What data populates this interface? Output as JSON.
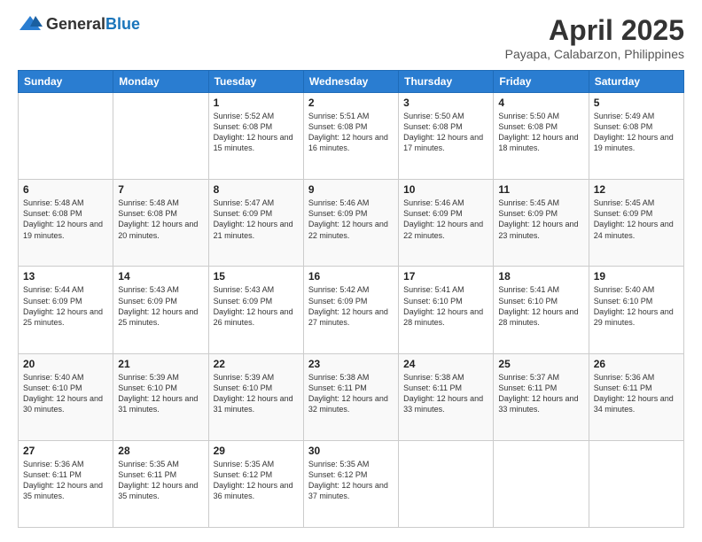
{
  "header": {
    "logo": {
      "general": "General",
      "blue": "Blue"
    },
    "title": "April 2025",
    "location": "Payapa, Calabarzon, Philippines"
  },
  "calendar": {
    "days_of_week": [
      "Sunday",
      "Monday",
      "Tuesday",
      "Wednesday",
      "Thursday",
      "Friday",
      "Saturday"
    ],
    "weeks": [
      [
        {
          "day": "",
          "info": ""
        },
        {
          "day": "",
          "info": ""
        },
        {
          "day": "1",
          "info": "Sunrise: 5:52 AM\nSunset: 6:08 PM\nDaylight: 12 hours and 15 minutes."
        },
        {
          "day": "2",
          "info": "Sunrise: 5:51 AM\nSunset: 6:08 PM\nDaylight: 12 hours and 16 minutes."
        },
        {
          "day": "3",
          "info": "Sunrise: 5:50 AM\nSunset: 6:08 PM\nDaylight: 12 hours and 17 minutes."
        },
        {
          "day": "4",
          "info": "Sunrise: 5:50 AM\nSunset: 6:08 PM\nDaylight: 12 hours and 18 minutes."
        },
        {
          "day": "5",
          "info": "Sunrise: 5:49 AM\nSunset: 6:08 PM\nDaylight: 12 hours and 19 minutes."
        }
      ],
      [
        {
          "day": "6",
          "info": "Sunrise: 5:48 AM\nSunset: 6:08 PM\nDaylight: 12 hours and 19 minutes."
        },
        {
          "day": "7",
          "info": "Sunrise: 5:48 AM\nSunset: 6:08 PM\nDaylight: 12 hours and 20 minutes."
        },
        {
          "day": "8",
          "info": "Sunrise: 5:47 AM\nSunset: 6:09 PM\nDaylight: 12 hours and 21 minutes."
        },
        {
          "day": "9",
          "info": "Sunrise: 5:46 AM\nSunset: 6:09 PM\nDaylight: 12 hours and 22 minutes."
        },
        {
          "day": "10",
          "info": "Sunrise: 5:46 AM\nSunset: 6:09 PM\nDaylight: 12 hours and 22 minutes."
        },
        {
          "day": "11",
          "info": "Sunrise: 5:45 AM\nSunset: 6:09 PM\nDaylight: 12 hours and 23 minutes."
        },
        {
          "day": "12",
          "info": "Sunrise: 5:45 AM\nSunset: 6:09 PM\nDaylight: 12 hours and 24 minutes."
        }
      ],
      [
        {
          "day": "13",
          "info": "Sunrise: 5:44 AM\nSunset: 6:09 PM\nDaylight: 12 hours and 25 minutes."
        },
        {
          "day": "14",
          "info": "Sunrise: 5:43 AM\nSunset: 6:09 PM\nDaylight: 12 hours and 25 minutes."
        },
        {
          "day": "15",
          "info": "Sunrise: 5:43 AM\nSunset: 6:09 PM\nDaylight: 12 hours and 26 minutes."
        },
        {
          "day": "16",
          "info": "Sunrise: 5:42 AM\nSunset: 6:09 PM\nDaylight: 12 hours and 27 minutes."
        },
        {
          "day": "17",
          "info": "Sunrise: 5:41 AM\nSunset: 6:10 PM\nDaylight: 12 hours and 28 minutes."
        },
        {
          "day": "18",
          "info": "Sunrise: 5:41 AM\nSunset: 6:10 PM\nDaylight: 12 hours and 28 minutes."
        },
        {
          "day": "19",
          "info": "Sunrise: 5:40 AM\nSunset: 6:10 PM\nDaylight: 12 hours and 29 minutes."
        }
      ],
      [
        {
          "day": "20",
          "info": "Sunrise: 5:40 AM\nSunset: 6:10 PM\nDaylight: 12 hours and 30 minutes."
        },
        {
          "day": "21",
          "info": "Sunrise: 5:39 AM\nSunset: 6:10 PM\nDaylight: 12 hours and 31 minutes."
        },
        {
          "day": "22",
          "info": "Sunrise: 5:39 AM\nSunset: 6:10 PM\nDaylight: 12 hours and 31 minutes."
        },
        {
          "day": "23",
          "info": "Sunrise: 5:38 AM\nSunset: 6:11 PM\nDaylight: 12 hours and 32 minutes."
        },
        {
          "day": "24",
          "info": "Sunrise: 5:38 AM\nSunset: 6:11 PM\nDaylight: 12 hours and 33 minutes."
        },
        {
          "day": "25",
          "info": "Sunrise: 5:37 AM\nSunset: 6:11 PM\nDaylight: 12 hours and 33 minutes."
        },
        {
          "day": "26",
          "info": "Sunrise: 5:36 AM\nSunset: 6:11 PM\nDaylight: 12 hours and 34 minutes."
        }
      ],
      [
        {
          "day": "27",
          "info": "Sunrise: 5:36 AM\nSunset: 6:11 PM\nDaylight: 12 hours and 35 minutes."
        },
        {
          "day": "28",
          "info": "Sunrise: 5:35 AM\nSunset: 6:11 PM\nDaylight: 12 hours and 35 minutes."
        },
        {
          "day": "29",
          "info": "Sunrise: 5:35 AM\nSunset: 6:12 PM\nDaylight: 12 hours and 36 minutes."
        },
        {
          "day": "30",
          "info": "Sunrise: 5:35 AM\nSunset: 6:12 PM\nDaylight: 12 hours and 37 minutes."
        },
        {
          "day": "",
          "info": ""
        },
        {
          "day": "",
          "info": ""
        },
        {
          "day": "",
          "info": ""
        }
      ]
    ]
  }
}
